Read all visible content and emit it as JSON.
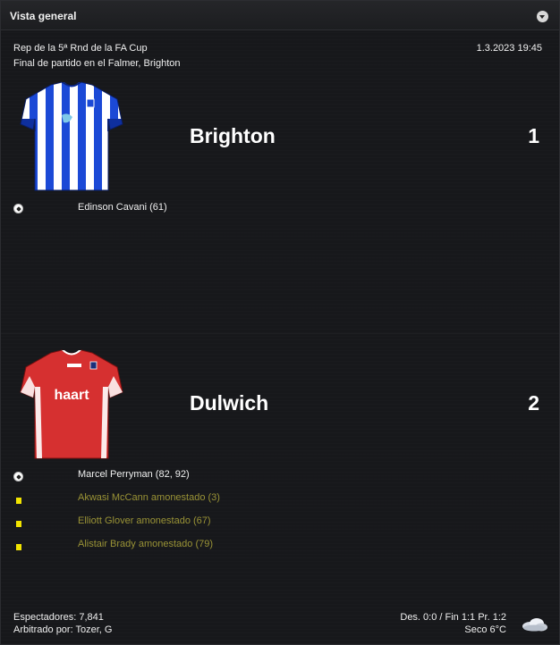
{
  "panel": {
    "title": "Vista general"
  },
  "match": {
    "competition": "Rep de la 5ª Rnd de la FA Cup",
    "status": "Final de partido en el Falmer, Brighton",
    "datetime": "1.3.2023 19:45"
  },
  "home": {
    "name": "Brighton",
    "score": "1",
    "kit_colors": [
      "#1c4ed8",
      "#ffffff"
    ],
    "events": [
      {
        "type": "goal",
        "icon": "ball-icon",
        "text": "Edinson Cavani (61)"
      }
    ]
  },
  "away": {
    "name": "Dulwich",
    "score": "2",
    "kit_sponsor": "haart",
    "kit_colors": [
      "#d22b2b",
      "#ffffff"
    ],
    "events": [
      {
        "type": "goal",
        "icon": "ball-icon",
        "text": "Marcel Perryman (82, 92)"
      },
      {
        "type": "booking",
        "icon": "yellow-card-icon",
        "text": "Akwasi McCann amonestado (3)"
      },
      {
        "type": "booking",
        "icon": "yellow-card-icon",
        "text": "Elliott Glover amonestado (67)"
      },
      {
        "type": "booking",
        "icon": "yellow-card-icon",
        "text": "Alistair Brady amonestado (79)"
      }
    ]
  },
  "footer": {
    "attendance": "Espectadores: 7,841",
    "referee": "Arbitrado por: Tozer, G",
    "scores_summary": "Des. 0:0 / Fin 1:1 Pr. 1:2",
    "weather": "Seco 6°C",
    "weather_icon": "cloud-icon"
  }
}
